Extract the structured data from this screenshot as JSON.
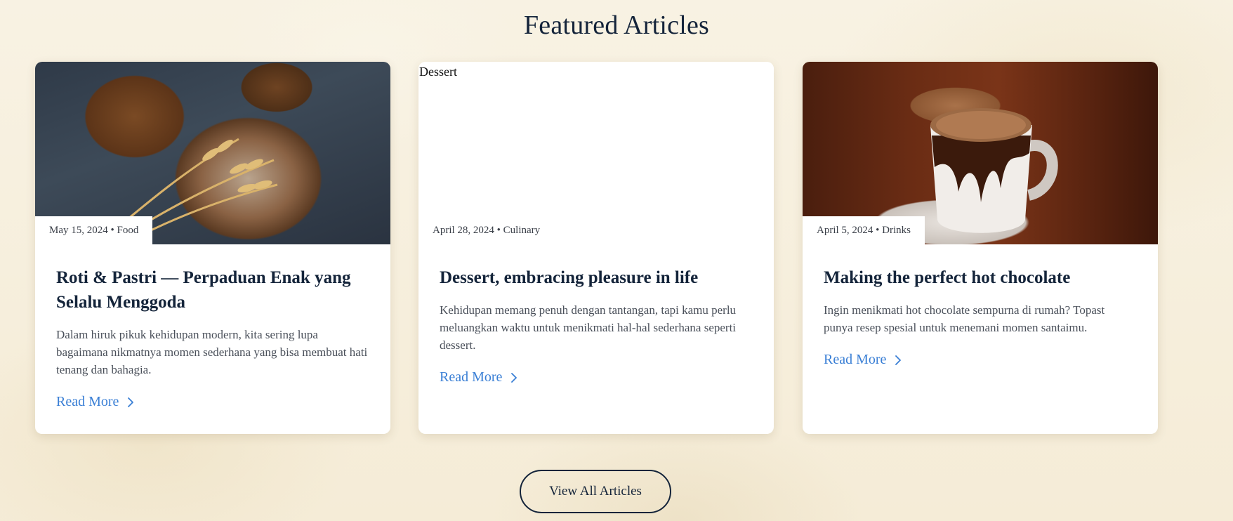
{
  "section": {
    "title": "Featured Articles"
  },
  "cards": [
    {
      "image_icon": "bread-photo",
      "meta": "May 15, 2024 • Food",
      "title": "Roti & Pastri — Perpaduan Enak yang Selalu Menggoda",
      "excerpt": "Dalam hiruk pikuk kehidupan modern, kita sering lupa bagaimana nikmatnya momen sederhana yang bisa membuat hati tenang dan bahagia.",
      "cta": "Read More"
    },
    {
      "image_alt": "Dessert",
      "meta": "April 28, 2024 • Culinary",
      "title": "Dessert, embracing pleasure in life",
      "excerpt": "Kehidupan memang penuh dengan tantangan, tapi kamu perlu meluangkan waktu untuk menikmati hal-hal sederhana seperti dessert.",
      "cta": "Read More"
    },
    {
      "image_icon": "hot-chocolate-photo",
      "meta": "April 5, 2024 • Drinks",
      "title": "Making the perfect hot chocolate",
      "excerpt": "Ingin menikmati hot chocolate sempurna di rumah? Topast punya resep spesial untuk menemani momen santaimu.",
      "cta": "Read More"
    }
  ],
  "view_all": {
    "label": "View All Articles"
  },
  "colors": {
    "accent_link": "#3a7fd5",
    "heading": "#14243a",
    "background": "#f7f0df"
  }
}
